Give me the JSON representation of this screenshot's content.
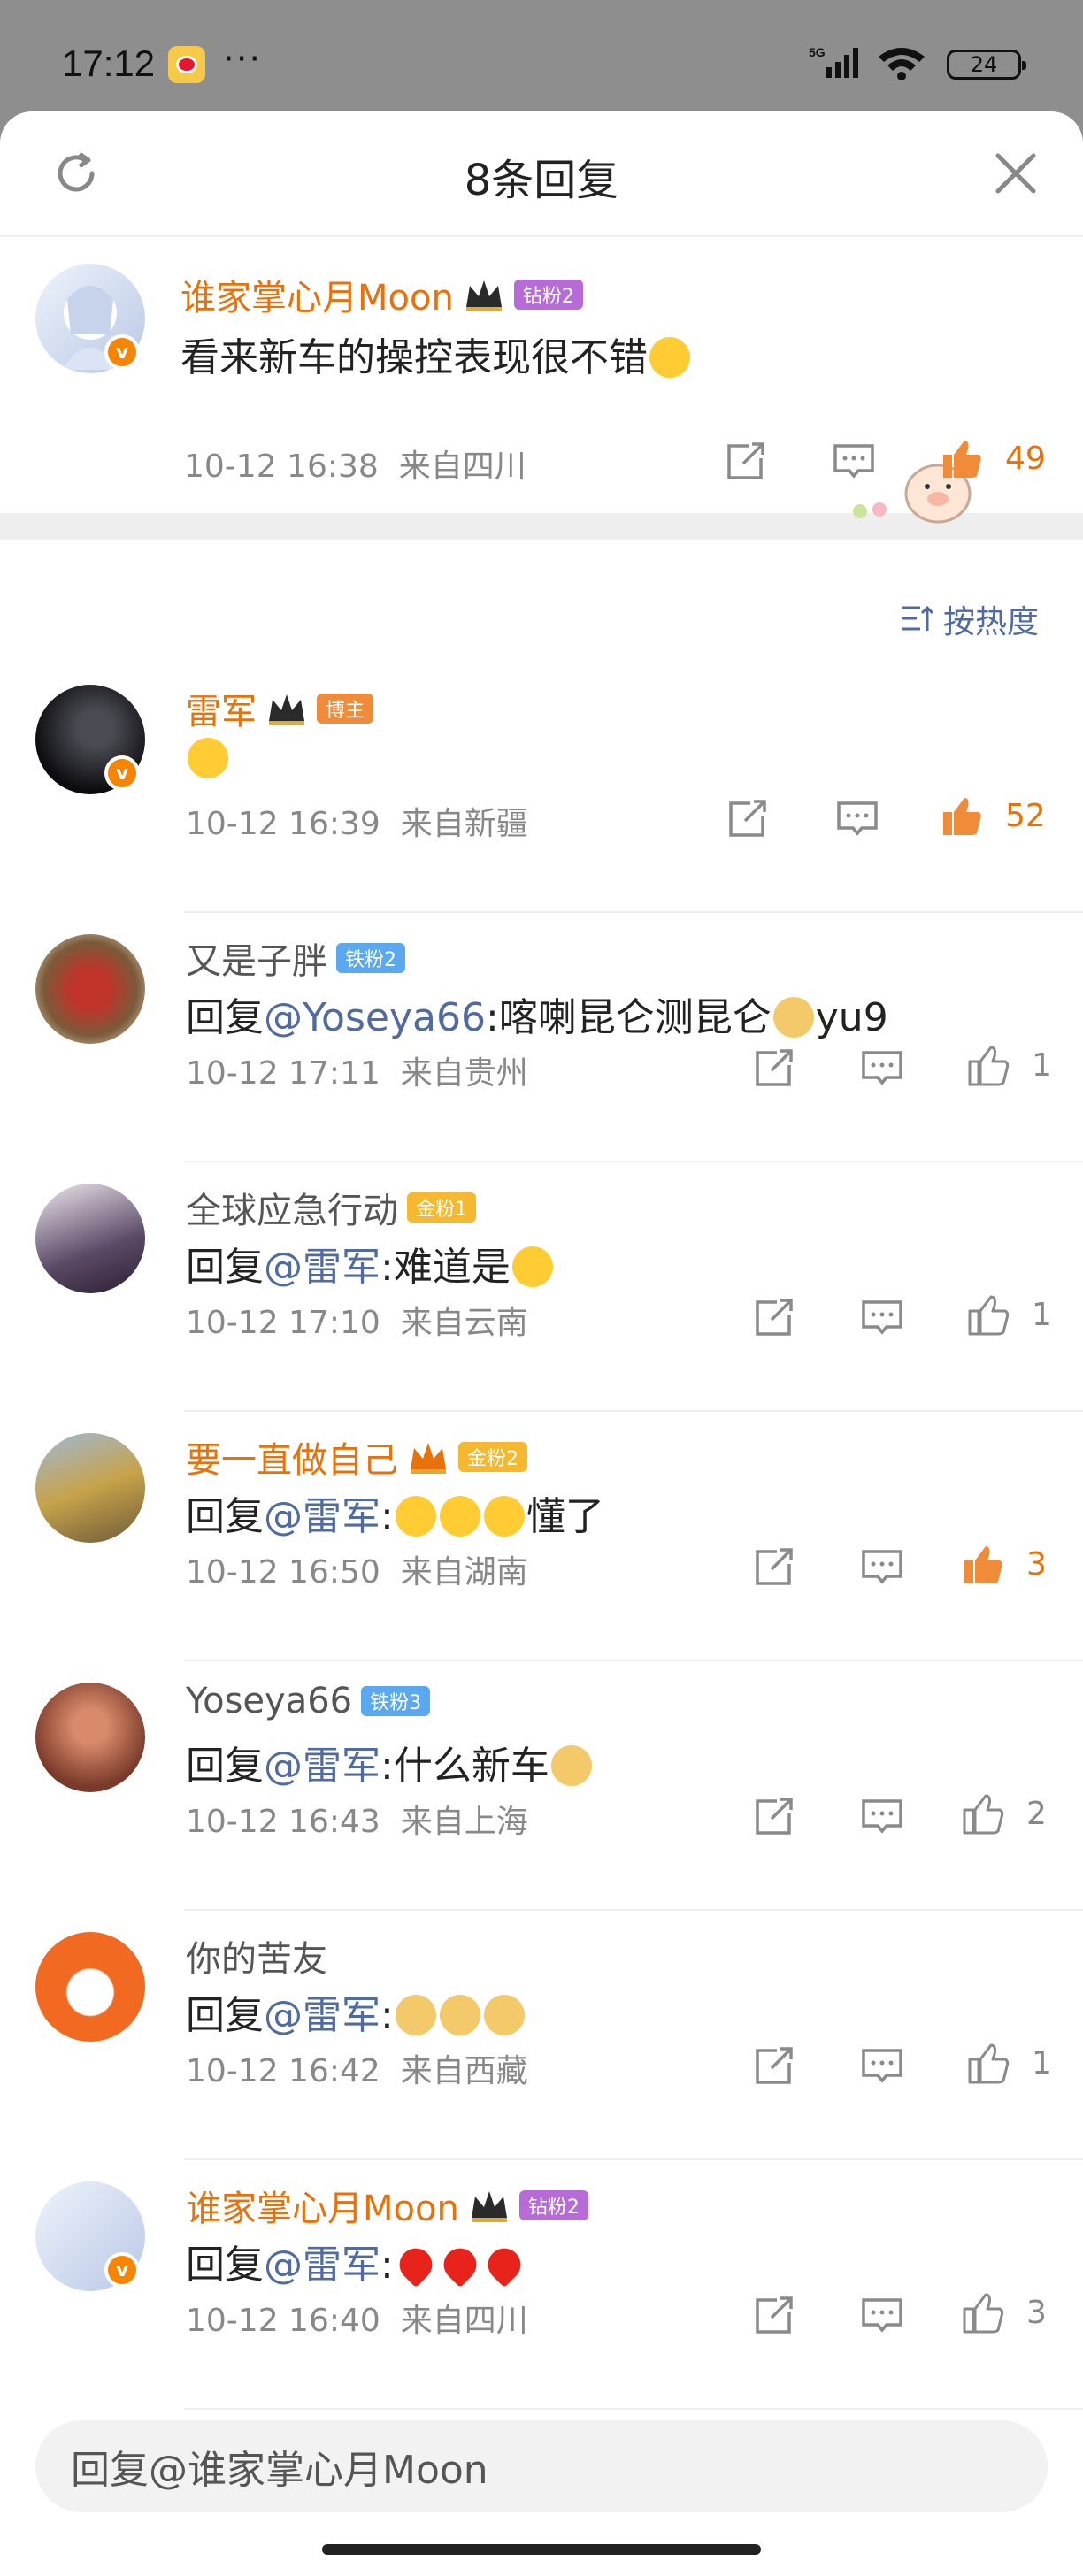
{
  "status": {
    "time": "17:12",
    "more": "···",
    "network": "5G",
    "battery": "24"
  },
  "header": {
    "title": "8条回复"
  },
  "root": {
    "user": "谁家掌心月Moon",
    "badge": "钻粉2",
    "text": "看来新车的操控表现很不错",
    "time": "10-12 16:38",
    "location": "来自四川",
    "likes": "49"
  },
  "sort": {
    "label": "按热度"
  },
  "replies": [
    {
      "user": "雷军",
      "badge": "博主",
      "prefix": "",
      "mention": "",
      "text": "",
      "time": "10-12 16:39",
      "location": "来自新疆",
      "likes": "52"
    },
    {
      "user": "又是子胖",
      "badge": "铁粉2",
      "prefix": "回复",
      "mention": "@Yoseya66",
      "text": ":喀喇昆仑测昆仑",
      "suffix": "yu9",
      "time": "10-12 17:11",
      "location": "来自贵州",
      "likes": "1"
    },
    {
      "user": "全球应急行动",
      "badge": "金粉1",
      "prefix": "回复",
      "mention": "@雷军",
      "text": ":难道是",
      "time": "10-12 17:10",
      "location": "来自云南",
      "likes": "1"
    },
    {
      "user": "要一直做自己",
      "badge": "金粉2",
      "prefix": "回复",
      "mention": "@雷军",
      "text": ":",
      "suffix": "懂了",
      "time": "10-12 16:50",
      "location": "来自湖南",
      "likes": "3"
    },
    {
      "user": "Yoseya66",
      "badge": "铁粉3",
      "prefix": "回复",
      "mention": "@雷军",
      "text": ":什么新车",
      "time": "10-12 16:43",
      "location": "来自上海",
      "likes": "2"
    },
    {
      "user": "你的苦友",
      "badge": "",
      "prefix": "回复",
      "mention": "@雷军",
      "text": ":",
      "time": "10-12 16:42",
      "location": "来自西藏",
      "likes": "1"
    },
    {
      "user": "谁家掌心月Moon",
      "badge": "钻粉2",
      "prefix": "回复",
      "mention": "@雷军",
      "text": ":",
      "time": "10-12 16:40",
      "location": "来自四川",
      "likes": "3"
    }
  ],
  "reply_input": {
    "placeholder": "回复@谁家掌心月Moon"
  },
  "colors": {
    "accent": "#e8710a",
    "link": "#4f6ba0",
    "like_active": "#f08b3a"
  }
}
